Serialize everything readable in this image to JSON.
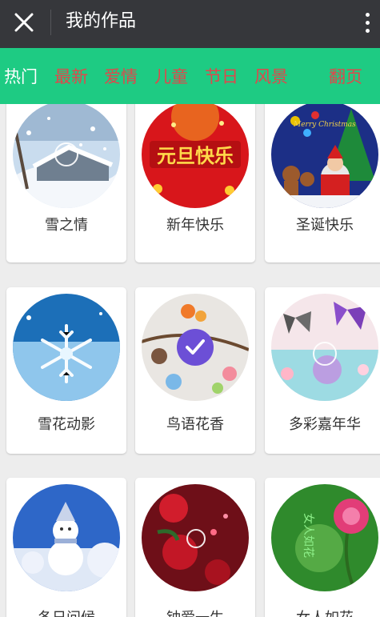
{
  "titlebar": {
    "title": "我的作品"
  },
  "tabs": [
    {
      "label": "热门",
      "active": true
    },
    {
      "label": "最新",
      "active": false
    },
    {
      "label": "爱情",
      "active": false
    },
    {
      "label": "儿童",
      "active": false
    },
    {
      "label": "节日",
      "active": false
    },
    {
      "label": "风景",
      "active": false
    }
  ],
  "page_turn_label": "翻页",
  "colors": {
    "titlebar": "#36373b",
    "tabbar": "#1ecb83",
    "active_tab": "#ffffff",
    "inactive_tab": "#e0474b",
    "check": "#6c4fd6"
  },
  "cards": [
    {
      "label": "雪之情",
      "thumb_icon": "snowy-cabin-image",
      "selected": false
    },
    {
      "label": "新年快乐",
      "thumb_icon": "new-year-lantern-image",
      "thumb_text": "元旦快乐",
      "selected": false
    },
    {
      "label": "圣诞快乐",
      "thumb_icon": "christmas-image",
      "thumb_text": "Merry Christmas",
      "selected": false
    },
    {
      "label": "雪花动影",
      "thumb_icon": "snowflake-image",
      "selected": false
    },
    {
      "label": "鸟语花香",
      "thumb_icon": "bird-flower-image",
      "selected": true
    },
    {
      "label": "多彩嘉年华",
      "thumb_icon": "butterfly-image",
      "selected": false
    },
    {
      "label": "冬日问候",
      "thumb_icon": "snowman-image",
      "selected": false
    },
    {
      "label": "钟爱一生",
      "thumb_icon": "red-roses-image",
      "selected": false
    },
    {
      "label": "女人如花",
      "thumb_icon": "pink-rose-image",
      "thumb_text": "女人如花",
      "selected": false
    }
  ]
}
